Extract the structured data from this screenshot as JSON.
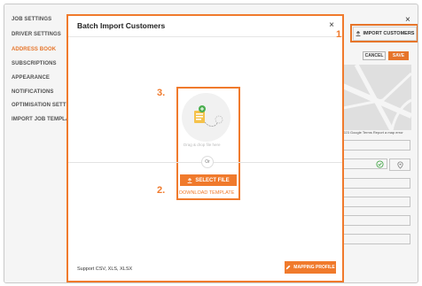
{
  "sidebar": {
    "items": [
      {
        "label": "JOB SETTINGS",
        "active": false
      },
      {
        "label": "DRIVER SETTINGS",
        "active": false
      },
      {
        "label": "ADDRESS BOOK",
        "active": true
      },
      {
        "label": "SUBSCRIPTIONS",
        "active": false
      },
      {
        "label": "APPEARANCE",
        "active": false
      },
      {
        "label": "NOTIFICATIONS",
        "active": false
      },
      {
        "label": "OPTIMISATION SETTINGS",
        "active": false
      },
      {
        "label": "IMPORT JOB TEMPLATE",
        "active": false
      }
    ]
  },
  "address_book": {
    "close_icon": "×",
    "import_label": "IMPORT CUSTOMERS",
    "cancel_label": "CANCEL",
    "save_label": "SAVE",
    "map_credit": "©2023 Google   Terms   Report a map error"
  },
  "modal": {
    "title": "Batch Import Customers",
    "close_icon": "×",
    "drag_text": "Drag & drop file here",
    "or_text": "Or",
    "select_label": "SELECT FILE",
    "download_label": "DOWNLOAD TEMPLATE",
    "support_text": "Support CSV, XLS, XLSX",
    "mapping_label": "MAPPING PROFILE"
  },
  "markers": {
    "one": "1.",
    "two": "2.",
    "three": "3."
  },
  "colors": {
    "accent": "#f07a2c"
  }
}
